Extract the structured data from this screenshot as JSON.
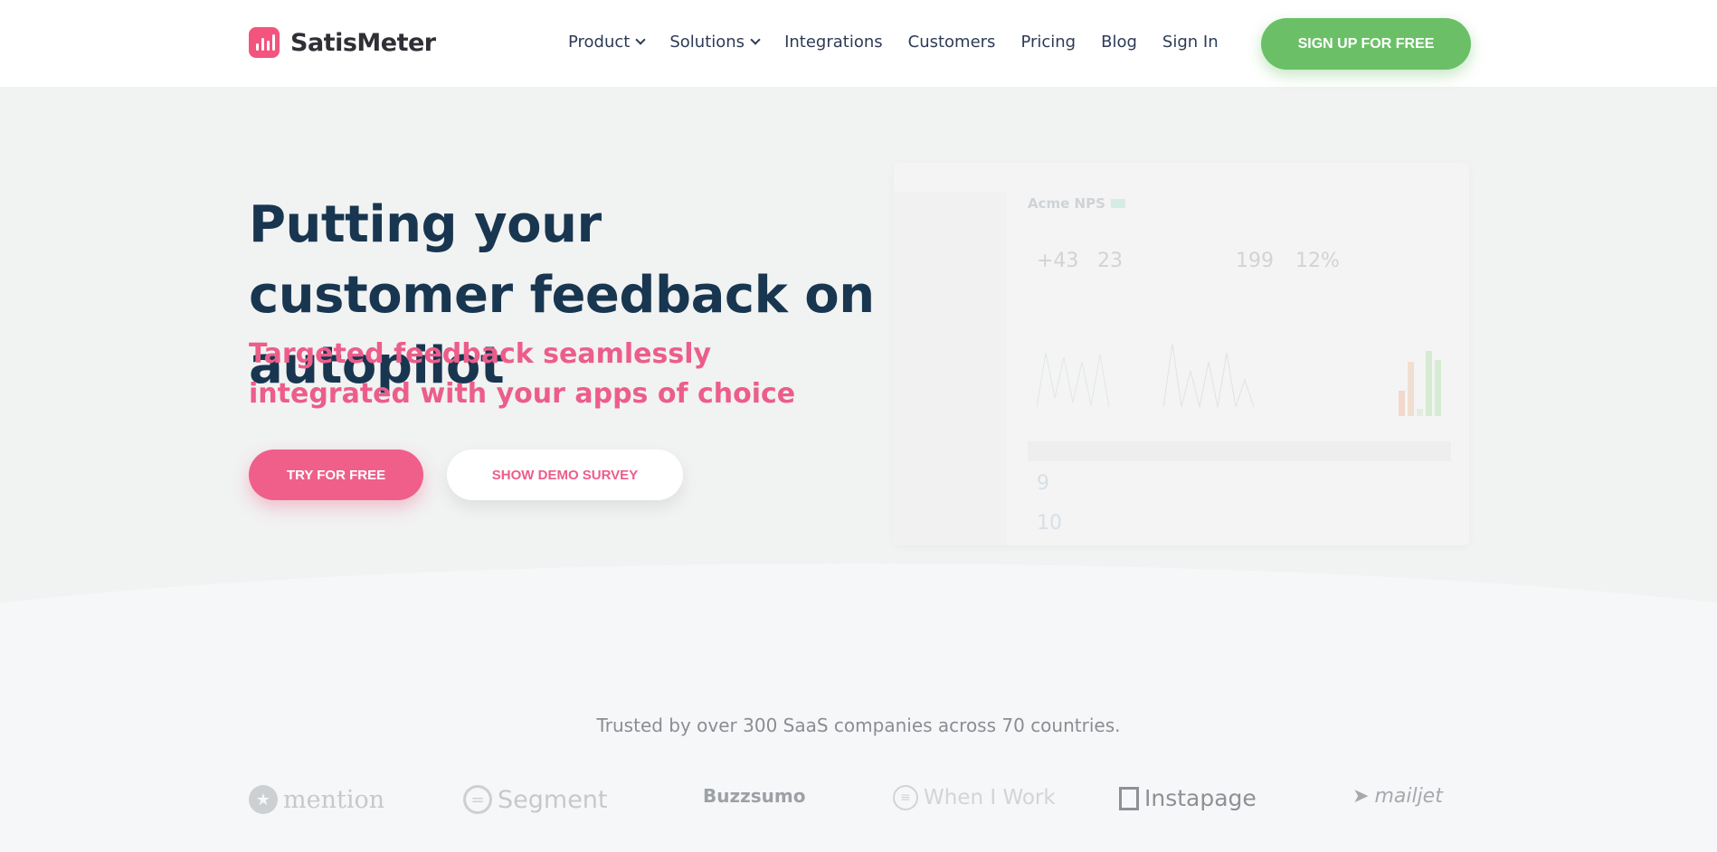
{
  "header": {
    "brand": "SatisMeter",
    "nav": [
      {
        "label": "Product",
        "dropdown": true
      },
      {
        "label": "Solutions",
        "dropdown": true
      },
      {
        "label": "Integrations"
      },
      {
        "label": "Customers"
      },
      {
        "label": "Pricing"
      },
      {
        "label": "Blog"
      },
      {
        "label": "Sign In"
      }
    ],
    "signup": "SIGN UP FOR FREE"
  },
  "hero": {
    "title": "Putting your customer feedback on autopilot",
    "subtitle": "Targeted feedback seamlessly integrated with your apps of choice",
    "try": "TRY FOR FREE",
    "demo": "SHOW DEMO SURVEY"
  },
  "mockup": {
    "title": "Acme NPS",
    "stats": [
      "+43",
      "23",
      "199",
      "12%"
    ],
    "scores": [
      "9",
      "10"
    ]
  },
  "trusted": "Trusted by over 300 SaaS companies across 70 countries.",
  "logos": [
    "mention",
    "Segment",
    "Buzzsumo",
    "When I Work",
    "Instapage",
    "mailjet"
  ],
  "colors": {
    "brand": "#f2547e",
    "green": "#6bc067",
    "pink": "#ec5d8a",
    "navy": "#183650"
  }
}
